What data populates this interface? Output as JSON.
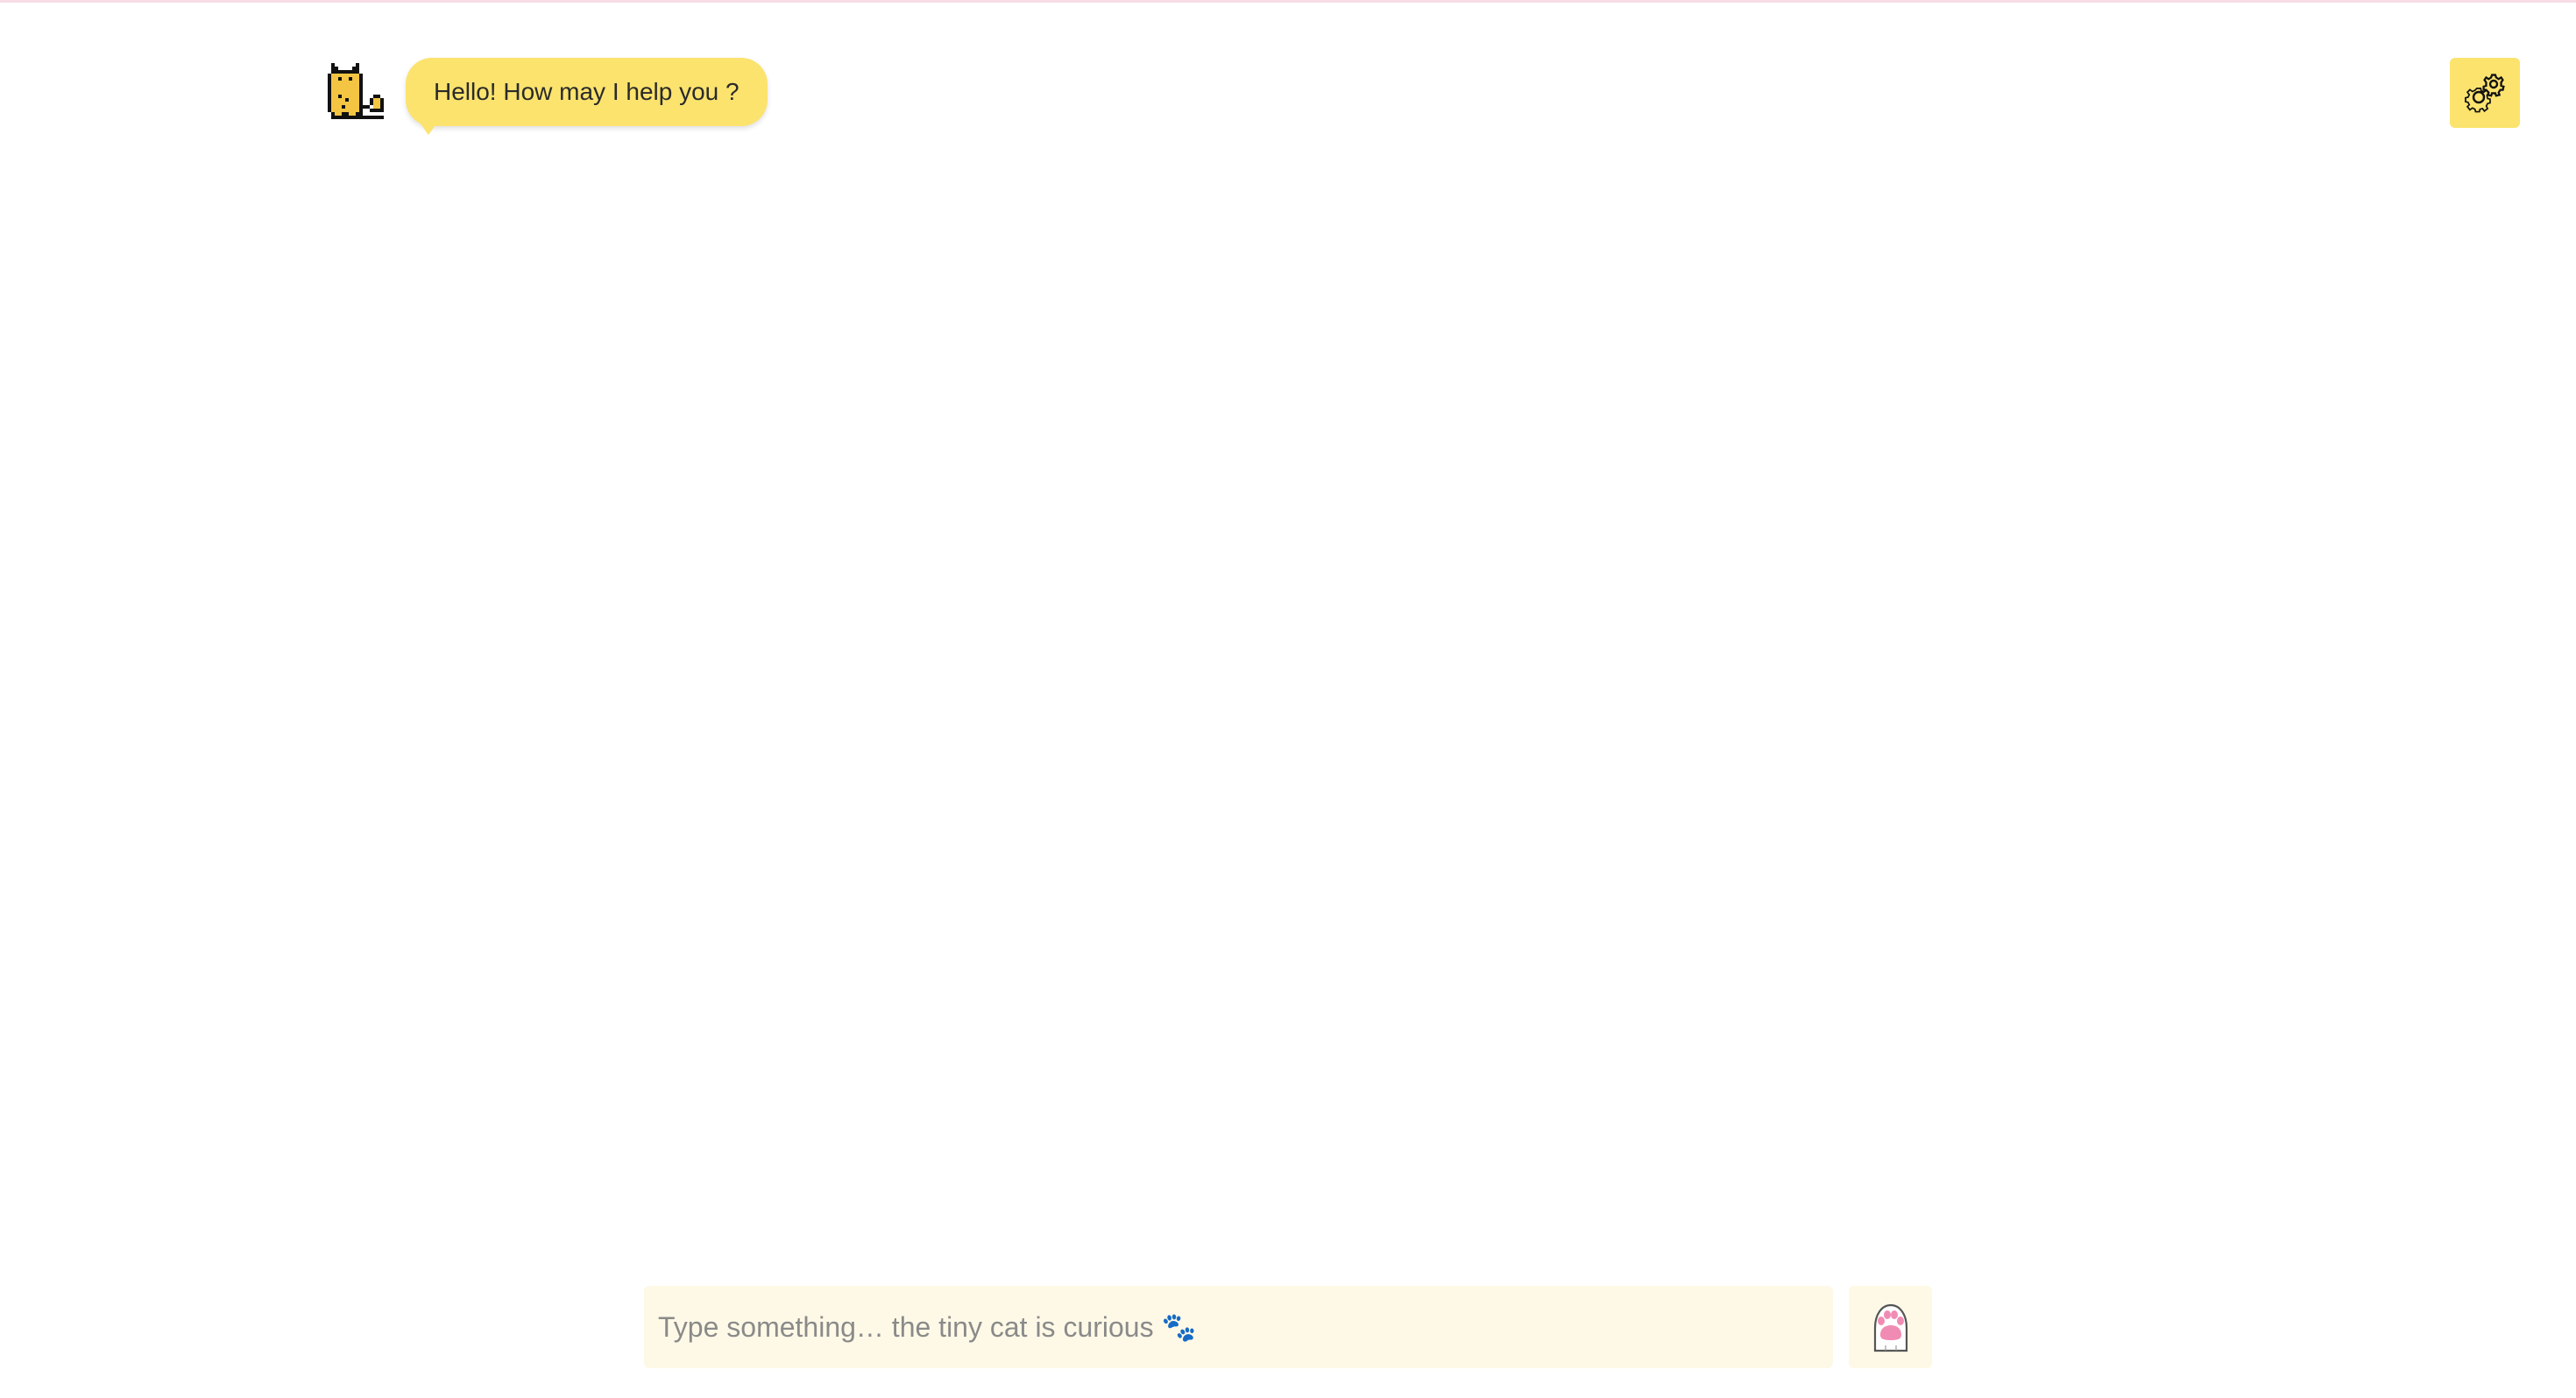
{
  "chat": {
    "greeting": "Hello! How may I help you ?"
  },
  "composer": {
    "placeholder": "Type something… the tiny cat is curious 🐾"
  },
  "icons": {
    "avatar": "pixel-cat-icon",
    "settings": "gear-icon",
    "send": "cat-paw-icon"
  },
  "colors": {
    "accent_yellow": "#fbe36e",
    "input_background": "#fdf9e6",
    "top_border": "#f7dce6"
  }
}
